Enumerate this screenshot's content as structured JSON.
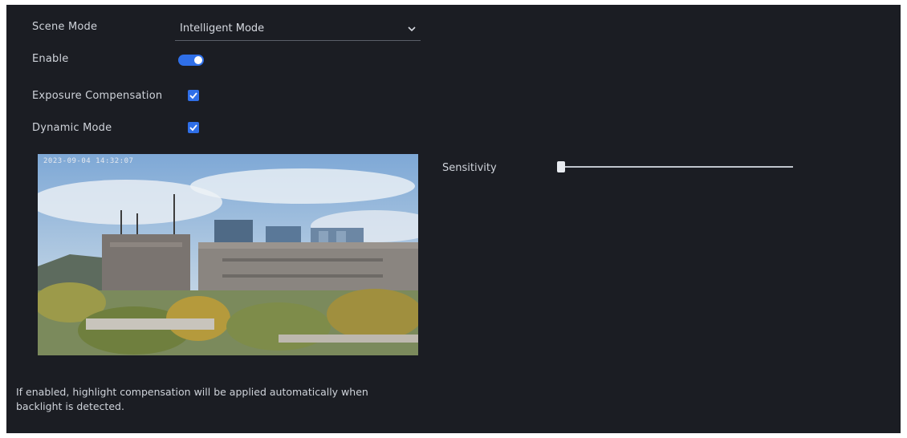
{
  "settings": {
    "scene_mode_label": "Scene Mode",
    "scene_mode_value": "Intelligent Mode",
    "enable_label": "Enable",
    "enable_on": true,
    "compensation_label": "Exposure Compensation",
    "compensation_checked": true,
    "dynamic_mode_label": "Dynamic Mode",
    "dynamic_mode_checked": true
  },
  "preview": {
    "timestamp": "2023-09-04 14:32:07"
  },
  "slider": {
    "label": "Sensitivity",
    "value": 0.02
  },
  "note": {
    "text": "If enabled, highlight compensation will be applied automatically when backlight is detected."
  },
  "colors": {
    "accent": "#2f6fe8",
    "panel_bg": "#1b1d23"
  }
}
